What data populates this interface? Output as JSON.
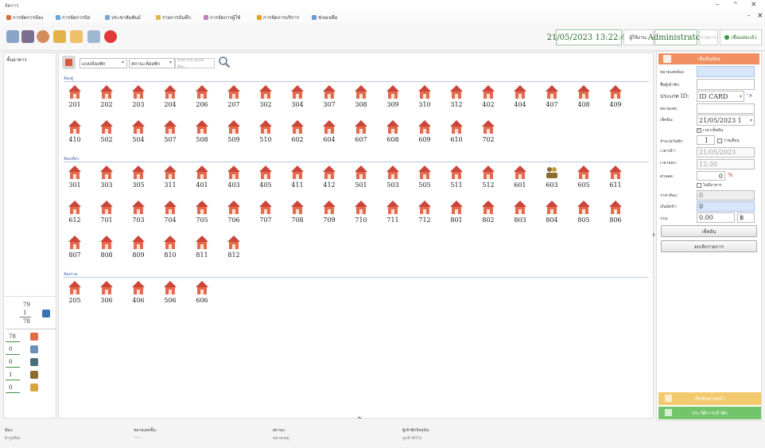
{
  "window": {
    "title": "จัดการ",
    "min_label": "–",
    "max_label": "^",
    "close_label": "×",
    "sub_min_label": "-",
    "sub_close_label": "×"
  },
  "menu": [
    {
      "label": "การจัดการห้อง",
      "icon": "home-icon",
      "color": "#e06b3a"
    },
    {
      "label": "การจัดการบิล",
      "icon": "bill-icon",
      "color": "#6aa8d8"
    },
    {
      "label": "ประชาสัมพันธ์",
      "icon": "info-icon",
      "color": "#7ba6cf"
    },
    {
      "label": "รายการบันทึก",
      "icon": "report-icon",
      "color": "#e3b34a"
    },
    {
      "label": "การจัดการผู้ใช้",
      "icon": "user-icon",
      "color": "#c47cc0"
    },
    {
      "label": "การจัดการบริการ",
      "icon": "service-icon",
      "color": "#e1a024"
    },
    {
      "label": "ช่วยเหลือ",
      "icon": "help-icon",
      "color": "#6a9bd0"
    }
  ],
  "toolbar": {
    "datetime": "21/05/2023 13:22:47",
    "role_label": "ผู้ใช้งาน:",
    "user": "Administrator",
    "pending_label": "รายการ",
    "connect_label": "เชื่อมต่อแล้ว",
    "icons": [
      "grid-icon",
      "building-icon",
      "clock-icon",
      "broom-icon",
      "key-icon",
      "wrench-icon",
      "power-icon"
    ]
  },
  "left_panel": {
    "header": "ชั้นอาคาร"
  },
  "counts": {
    "total": "79",
    "reserved": "1",
    "available": "78",
    "list": [
      {
        "value": "78",
        "icon": "house-icon"
      },
      {
        "value": "0",
        "icon": "clean-icon"
      },
      {
        "value": "0",
        "icon": "repair-icon"
      },
      {
        "value": "1",
        "icon": "guest-icon"
      },
      {
        "value": "0",
        "icon": "booking-icon"
      }
    ]
  },
  "filters": {
    "type_select": "แบบห้องพัก",
    "status_select": "สถานะห้องพัก",
    "search_placeholder": "ค้นหาหมายเลขห้อง..."
  },
  "groups": [
    {
      "label": "ห้องคู่",
      "rows": [
        [
          "201",
          "202",
          "203",
          "204",
          "206",
          "207",
          "302",
          "304",
          "307",
          "308",
          "309",
          "310",
          "312",
          "402",
          "404",
          "407",
          "408",
          "409"
        ],
        [
          "410",
          "502",
          "504",
          "507",
          "508",
          "509",
          "510",
          "602",
          "604",
          "607",
          "608",
          "609",
          "610",
          "702"
        ]
      ]
    },
    {
      "label": "ห้องเดี่ยว",
      "rows": [
        [
          "301",
          "303",
          "305",
          "311",
          "401",
          "403",
          "405",
          "411",
          "412",
          "501",
          "503",
          "505",
          "511",
          "512",
          "601",
          "603",
          "605",
          "611"
        ],
        [
          "612",
          "701",
          "703",
          "704",
          "705",
          "706",
          "707",
          "708",
          "709",
          "710",
          "711",
          "712",
          "801",
          "802",
          "803",
          "804",
          "805",
          "806"
        ],
        [
          "807",
          "808",
          "809",
          "810",
          "811",
          "812"
        ]
      ]
    },
    {
      "label": "ห้องรวม",
      "rows": [
        [
          "205",
          "306",
          "406",
          "506",
          "606"
        ]
      ]
    }
  ],
  "occupied_room": "603",
  "room_colors": {
    "available": "#e46a4a",
    "roof": "#c9463b",
    "occupied": "#8b6b2e"
  },
  "right_panel": {
    "header": "เช็คอินห้อง",
    "fields": {
      "room_no_label": "หมายเลขห้อง:",
      "guest_name_label": "ชื่อผู้เข้าพัก:",
      "id_type_label": "ประเภท ID:",
      "id_type_value": "ID CARD",
      "id_no_label": "หมายเลข:",
      "checkin_label": "เช็คอิน:",
      "checkin_value": "21/05/2023 1",
      "time_in_check": "เวลาเช็คอิน",
      "days_label": "จำนวนวันพัก:",
      "days_value": "1",
      "monthly_check": "รายเดือน",
      "date_label": "เวลาเข้า:",
      "date_value": "21/05/2023",
      "time_label": "เวลาออก:",
      "time_value": "12:30",
      "discount_label": "ส่วนลด:",
      "discount_value": "0",
      "discount_unit": "%",
      "breakfast_check": "ไม่มีอาหาร",
      "price_label": "ราคาห้อง:",
      "price_value": "0",
      "deposit_label": "เงินมัดจำ:",
      "deposit_value": "0",
      "total_label": "รวม:",
      "total_value": "0.00",
      "currency": "฿"
    },
    "checkin_button": "เช็คอิน",
    "clear_button": "ยกเลิกรายการ",
    "bottom_bar_1": "เช็คอินล่วงหน้า",
    "bottom_bar_2": "ประวัติการเข้าพัก",
    "bottom_colors": [
      "#f2c96c",
      "#72c56a"
    ]
  },
  "status": {
    "room_label": "ห้อง:",
    "room_sub": "ผ้าปูเตียง",
    "roomno_label": "หมายเลขชั้น:",
    "roomno_sub": "-----",
    "state_label": "สถานะ:",
    "state_sub": "หมายเหตุ",
    "guest_label": "ผู้เข้าพักปัจจุบัน:",
    "guest_sub": "ลูกค้าทั่วไป"
  }
}
